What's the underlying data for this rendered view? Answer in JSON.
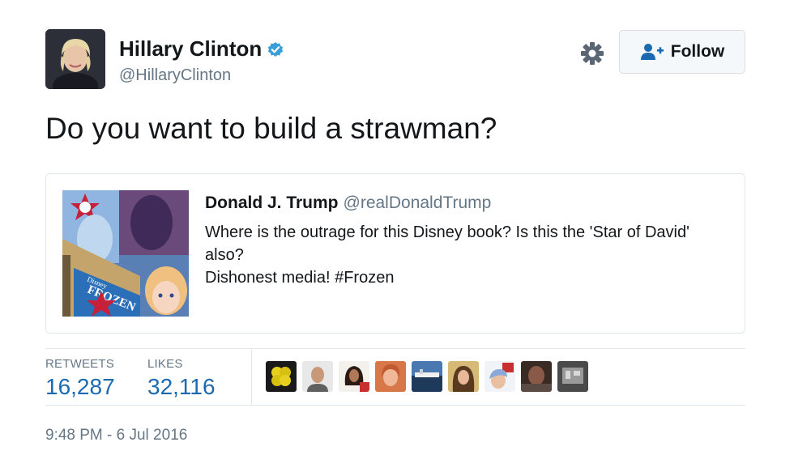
{
  "author": {
    "name": "Hillary Clinton",
    "handle": "@HillaryClinton"
  },
  "follow_button": {
    "label": "Follow"
  },
  "tweet": {
    "text": "Do you want to build a strawman?"
  },
  "quoted": {
    "name": "Donald J. Trump",
    "handle": "@realDonaldTrump",
    "lines": [
      "Where is the outrage for this Disney book? Is this the 'Star of David' also?",
      "Dishonest media! #Frozen"
    ],
    "image_text": {
      "brand": "Disney",
      "title": "FROZEN"
    }
  },
  "stats": {
    "retweets_label": "RETWEETS",
    "retweets_value": "16,287",
    "likes_label": "LIKES",
    "likes_value": "32,116"
  },
  "timestamp": "9:48 PM - 6 Jul 2016",
  "colors": {
    "accent_blue": "#1b6ab0",
    "muted": "#657786",
    "verified": "#3a9fd8"
  }
}
